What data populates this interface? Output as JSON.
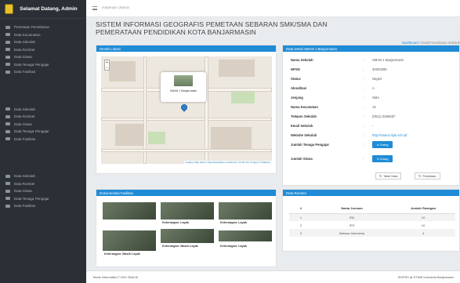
{
  "sidebar": {
    "greeting": "Selamat Datang, Admin",
    "group1": [
      {
        "label": "Pemetaan Persebaran",
        "icon": "globe-icon"
      },
      {
        "label": "Data Kecamatan",
        "icon": "map-pin-icon"
      },
      {
        "label": "Data Sekolah",
        "icon": "school-icon"
      },
      {
        "label": "Data Rombel",
        "icon": "users-icon"
      },
      {
        "label": "Data Siswa",
        "icon": "student-icon"
      },
      {
        "label": "Data Tenaga Pengajar",
        "icon": "teacher-icon"
      },
      {
        "label": "Data Fasilitas",
        "icon": "building-icon"
      }
    ],
    "group2": [
      {
        "label": "Data Sekolah",
        "icon": "school-icon"
      },
      {
        "label": "Data Rombel",
        "icon": "users-icon"
      },
      {
        "label": "Data Siswa",
        "icon": "student-icon"
      },
      {
        "label": "Data Tenaga Pengajar",
        "icon": "teacher-icon"
      },
      {
        "label": "Data Fasilitas",
        "icon": "building-icon"
      }
    ],
    "group3": [
      {
        "label": "Data Sekolah",
        "icon": "school-icon"
      },
      {
        "label": "Data Rombel",
        "icon": "users-icon"
      },
      {
        "label": "Data Siswa",
        "icon": "student-icon"
      },
      {
        "label": "Data Tenaga Pengajar",
        "icon": "teacher-icon"
      },
      {
        "label": "Data Fasilitas",
        "icon": "building-icon"
      }
    ]
  },
  "topbar": {
    "title": "Halaman Utama"
  },
  "page": {
    "title_line1": "SISTEM INFORMASI GEOGRAFIS PEMETAAN SEBARAN SMK/SMA DAN",
    "title_line2": "PEMERATAAN PENDIDIKAN KOTA BANJARMASIN",
    "breadcrumb_active": "Dashboard",
    "breadcrumb_sep": "/",
    "breadcrumb_current": "Detail Persebaran Sekolah"
  },
  "map_card": {
    "header": "Denah Lokasi",
    "popup_label": "SMAN 1 Banjarmasin",
    "zoom_in": "+",
    "zoom_out": "−",
    "attribution": "Leaflet | Map data © OpenStreetMap contributors, CC-BY-SA, Imagery © Mapbox"
  },
  "detail_card": {
    "header": "Data Detail SMAN 1 Banjarmasin",
    "rows": [
      {
        "key": "Nama Sekolah",
        "value": "SMAN 1 Banjarmasin"
      },
      {
        "key": "NPSN",
        "value": "30304280"
      },
      {
        "key": "Status",
        "value": "Negeri"
      },
      {
        "key": "Akreditasi",
        "value": "A"
      },
      {
        "key": "Jenjang",
        "value": "SMA"
      },
      {
        "key": "Nama Kecamatan",
        "value": "13"
      },
      {
        "key": "Telepon Sekolah",
        "value": "(0511) 3365467"
      },
      {
        "key": "Email Sekolah",
        "value": "-"
      },
      {
        "key": "Website Sekolah",
        "value": "http://sman1-bjm.sch.id/"
      }
    ],
    "teacher_label": "Jumlah Tenaga Pengajar",
    "teacher_value": "6 Orang",
    "student_label": "Jumlah Siswa",
    "student_value": "5 Orang",
    "sep": ":",
    "btn_table": "Tabel Data",
    "btn_back": "Pemetaan"
  },
  "facility_card": {
    "header": "Dokumentasi Fasilitas",
    "captions": [
      "Keterangan: Layak",
      "Keterangan: Layak",
      "Keterangan: Masih Layak",
      "Keterangan: Masih Layak",
      "Keterangan: Layak"
    ]
  },
  "rombel_card": {
    "header": "Data Rombel",
    "columns": [
      "#",
      "Nama Jurusan",
      "Jumlah Ruangan"
    ],
    "rows": [
      {
        "no": "1",
        "jurusan": "IPA",
        "ruangan": "10"
      },
      {
        "no": "2",
        "jurusan": "IPS",
        "ruangan": "10"
      },
      {
        "no": "3",
        "jurusan": "Bahasa Indonesia",
        "ruangan": "4"
      }
    ]
  },
  "footer": {
    "left": "Teknik Informatika © 2021 SMA-NI",
    "right": "SIGPSS @ STMIK Indonesia Banjarmasin"
  }
}
